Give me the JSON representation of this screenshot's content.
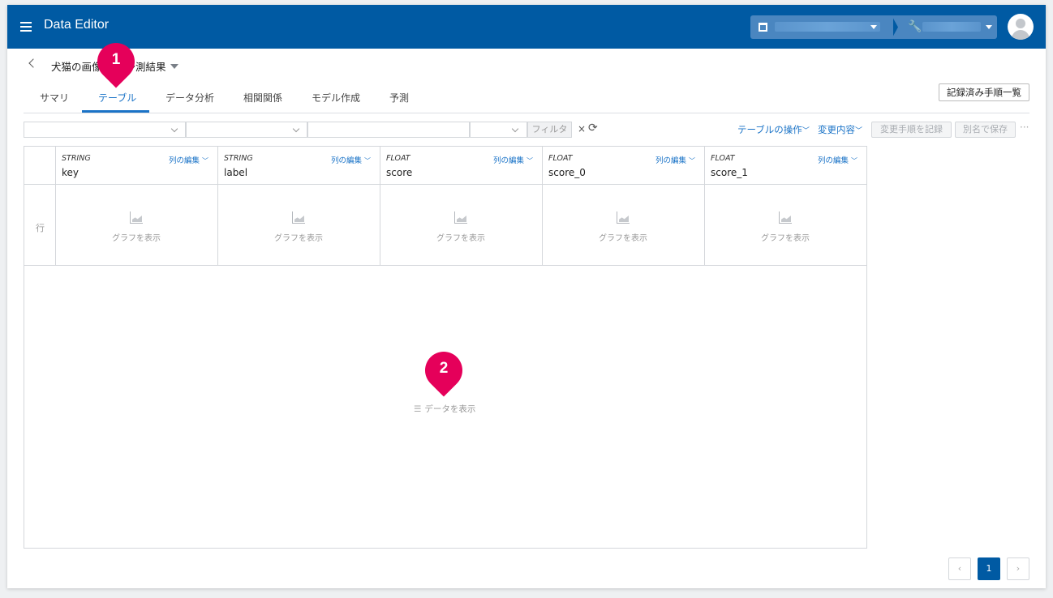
{
  "app": {
    "title": "Data Editor"
  },
  "breadcrumb": {
    "title": "犬猫の画像分類 予測結果"
  },
  "tabs": [
    {
      "label": "サマリ"
    },
    {
      "label": "テーブル"
    },
    {
      "label": "データ分析"
    },
    {
      "label": "相関関係"
    },
    {
      "label": "モデル作成"
    },
    {
      "label": "予測"
    }
  ],
  "recorded_steps_button": "記録済み手順一覧",
  "filter": {
    "button": "フィルタ",
    "clear": "×",
    "refresh": "⟳"
  },
  "actions": {
    "table_ops": "テーブルの操作",
    "changes": "変更内容",
    "record_steps": "変更手順を記録",
    "save_as": "別名で保存",
    "more": "···"
  },
  "table": {
    "row_label": "行",
    "graph_label": "グラフを表示",
    "edit_label": "列の編集",
    "show_data": "データを表示",
    "columns": [
      {
        "type": "STRING",
        "name": "key"
      },
      {
        "type": "STRING",
        "name": "label"
      },
      {
        "type": "FLOAT",
        "name": "score"
      },
      {
        "type": "FLOAT",
        "name": "score_0"
      },
      {
        "type": "FLOAT",
        "name": "score_1"
      }
    ]
  },
  "pins": [
    {
      "num": "1"
    },
    {
      "num": "2"
    }
  ],
  "pagination": {
    "prev": "‹",
    "current": "1",
    "next": "›"
  },
  "colors": {
    "primary": "#005aa3",
    "accent": "#1a73c7",
    "pin": "#e5005a"
  }
}
